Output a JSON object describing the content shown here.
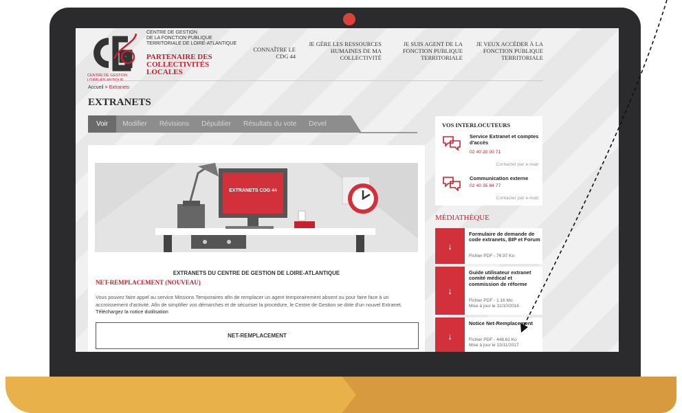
{
  "org": {
    "logo_text": "CENTRE DE GESTION LOIRE-ATLANTIQUE",
    "name_lines": [
      "CENTRE DE GESTION",
      "DE LA FONCTION PUBLIQUE",
      "TERRITORIALE DE LOIRE-ATLANTIQUE"
    ],
    "tagline": "PARTENAIRE DES COLLECTIVITÉS LOCALES"
  },
  "nav": [
    {
      "label": "CONNAÎTRE LE CDG 44"
    },
    {
      "label": "JE GÈRE LES RESSOURCES HUMAINES DE MA COLLECTIVITÉ"
    },
    {
      "label": "JE SUIS AGENT DE LA FONCTION PUBLIQUE TERRITORIALE"
    },
    {
      "label": "JE VEUX ACCÉDER À LA FONCTION PUBLIQUE TERRITORIALE"
    }
  ],
  "breadcrumb": {
    "home": "Accueil",
    "separator": ">",
    "current": "Extranets"
  },
  "page_title": "EXTRANETS",
  "tabs": [
    "Voir",
    "Modifier",
    "Révisions",
    "Dépublier",
    "Résultats du vote",
    "Devel"
  ],
  "illustration": {
    "screen_text": "EXTRANETS CDG 44"
  },
  "main": {
    "title": "EXTRANETS DU CENTRE DE GESTION DE LOIRE-ATLANTIQUE",
    "subtitle": "NET-REMPLACEMENT (NOUVEAU)",
    "paragraph": "Vous pouvez faire appel au service Missions Temporaires afin de remplacer un agent temporairement absent ou pour faire face à un accroissement d'activité. Afin de simplifier vos démarches et de sécuriser la procédure, le Centre de Gestion se dote d'un nouvel Extranet.",
    "paragraph_link": "Téléchargez la notice dutilisation",
    "button": "NET-REMPLACEMENT"
  },
  "interlocuteurs": {
    "heading": "VOS INTERLOCUTEURS",
    "contacts": [
      {
        "name": "Service Extranet et comptes d'accès",
        "phone": "02 40 20 00 71",
        "mail": "Contacter par e-mail"
      },
      {
        "name": "Communication externe",
        "phone": "02 40 35 84 77",
        "mail": "Contacter par e-mail"
      }
    ]
  },
  "mediatheque": {
    "heading": "MÉDIATHÈQUE",
    "docs": [
      {
        "title": "Formulaire de demande de code extranets, BIP et Forum",
        "meta": "Fichier PDF - 76.97 Ko",
        "update": ""
      },
      {
        "title": "Guide utilisateur extranet comité médical et commission de réforme",
        "meta": "Fichier PDF - 1.16 Mo",
        "update": "Mise à jour le 31/10/2016"
      },
      {
        "title": "Notice Net-Remplacement",
        "meta": "Fichier PDF - 448.62 Ko",
        "update": "Mise à jour le 13/11/2017"
      }
    ]
  },
  "colors": {
    "brand_red": "#c8202f",
    "laptop_frame": "#2b2b2d",
    "base_light": "#e8b14a",
    "base_dark": "#d79a3f"
  }
}
